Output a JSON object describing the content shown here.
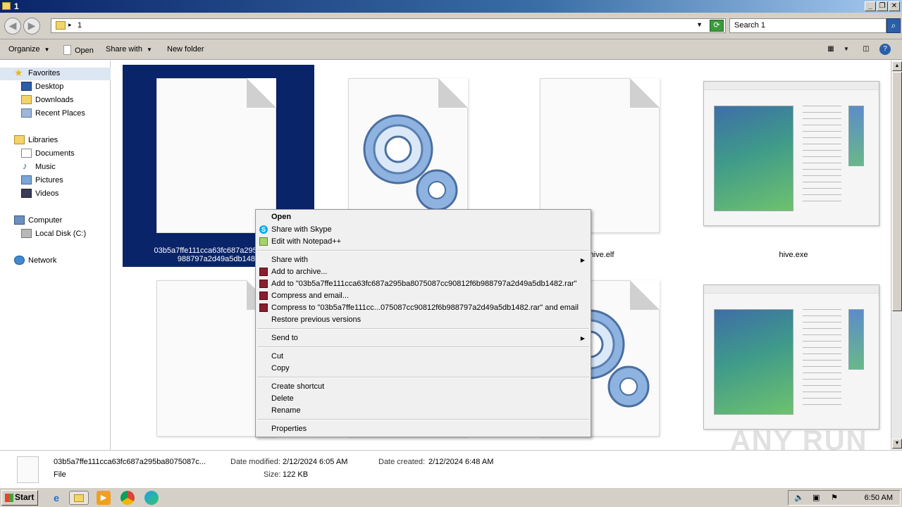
{
  "window": {
    "title": "1"
  },
  "address": {
    "path": "1",
    "search_placeholder": "Search 1"
  },
  "toolbar": {
    "organize": "Organize",
    "open": "Open",
    "share_with": "Share with",
    "new_folder": "New folder"
  },
  "nav": {
    "favorites": "Favorites",
    "favorites_items": [
      "Desktop",
      "Downloads",
      "Recent Places"
    ],
    "libraries": "Libraries",
    "libraries_items": [
      "Documents",
      "Music",
      "Pictures",
      "Videos"
    ],
    "computer": "Computer",
    "computer_items": [
      "Local Disk (C:)"
    ],
    "network": "Network"
  },
  "files": [
    {
      "name_line1": "03b5a7ffe111cca63fc687a295ba8075",
      "name_line2": "988797a2d49a5db1482",
      "icon": "blank-file-icon",
      "selected": true
    },
    {
      "name": "",
      "icon": "gears-icon"
    },
    {
      "name": "hive.elf",
      "icon": "blank-file-icon"
    },
    {
      "name": "hive.exe",
      "icon": "window-app-icon"
    },
    {
      "name": "",
      "icon": "blank-file-icon"
    },
    {
      "name": "",
      "icon": "gears-icon"
    },
    {
      "name": "",
      "icon": "blank-file-icon"
    },
    {
      "name": "",
      "icon": "window-app-icon"
    }
  ],
  "context_menu": {
    "open": "Open",
    "share_skype": "Share with Skype",
    "edit_notepad": "Edit with Notepad++",
    "share_with": "Share with",
    "add_archive": "Add to archive...",
    "add_to_rar": "Add to \"03b5a7ffe111cca63fc687a295ba8075087cc90812f6b988797a2d49a5db1482.rar\"",
    "compress_email": "Compress and email...",
    "compress_rar_email": "Compress to \"03b5a7ffe111cc...075087cc90812f6b988797a2d49a5db1482.rar\" and email",
    "restore": "Restore previous versions",
    "send_to": "Send to",
    "cut": "Cut",
    "copy": "Copy",
    "create_shortcut": "Create shortcut",
    "delete": "Delete",
    "rename": "Rename",
    "properties": "Properties"
  },
  "details": {
    "name": "03b5a7ffe111cca63fc687a295ba8075087c...",
    "type": "File",
    "date_modified_label": "Date modified:",
    "date_modified": "2/12/2024 6:05 AM",
    "date_created_label": "Date created:",
    "date_created": "2/12/2024 6:48 AM",
    "size_label": "Size:",
    "size": "122 KB"
  },
  "taskbar": {
    "start": "Start",
    "clock": "6:50 AM"
  },
  "watermark": "ANY RUN"
}
